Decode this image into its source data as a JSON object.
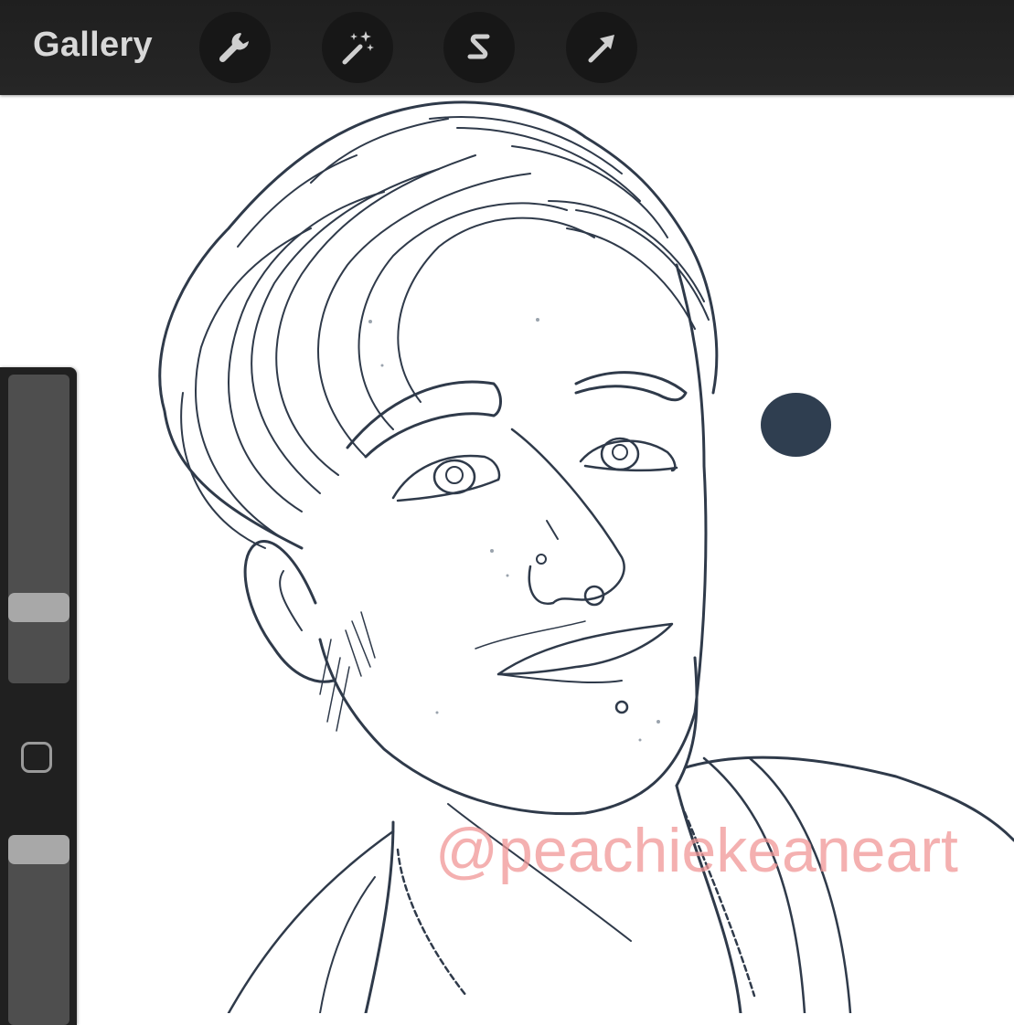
{
  "topbar": {
    "gallery_label": "Gallery",
    "tools": [
      {
        "name": "wrench-icon",
        "label": "Actions"
      },
      {
        "name": "magic-wand-icon",
        "label": "Adjustments"
      },
      {
        "name": "selection-s-icon",
        "label": "Selection"
      },
      {
        "name": "arrow-cursor-icon",
        "label": "Transform"
      }
    ]
  },
  "canvas": {
    "watermark": "@peachiekeaneart"
  },
  "sidebar": {
    "brush_size": 0.22,
    "brush_opacity": 1.0,
    "modify_button_icon": "square-icon"
  },
  "colors": {
    "topbar_bg": "#232323",
    "tool_bg": "#171717",
    "icon": "#cfcfcf",
    "current_color": "#2f3e50",
    "sidebar_bg": "#202020",
    "slider_track": "#4e4e4e",
    "slider_handle": "#a8a8a8"
  }
}
